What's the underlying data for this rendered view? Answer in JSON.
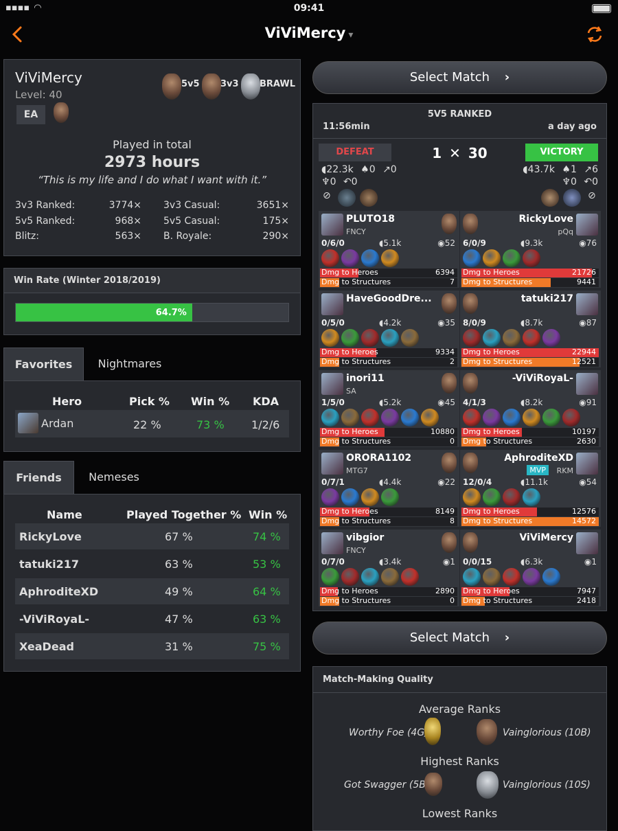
{
  "status_bar": {
    "time": "09:41"
  },
  "nav": {
    "title": "ViViMercy",
    "caret": "▾"
  },
  "profile": {
    "name": "ViViMercy",
    "level": "Level: 40",
    "region": "EA",
    "modes": [
      "5v5",
      "3v3",
      "BRAWL"
    ],
    "played_label": "Played in total",
    "hours": "2973 hours",
    "quote": "“This is my life and I do what I want with it.”",
    "stats": [
      {
        "label": "3v3 Ranked:",
        "value": "3774×"
      },
      {
        "label": "3v3 Casual:",
        "value": "3651×"
      },
      {
        "label": "5v5 Ranked:",
        "value": "968×"
      },
      {
        "label": "5v5 Casual:",
        "value": "175×"
      },
      {
        "label": "Blitz:",
        "value": "563×"
      },
      {
        "label": "B. Royale:",
        "value": "290×"
      }
    ]
  },
  "win_rate": {
    "title": "Win Rate (Winter 2018/2019)",
    "value": "64.7%",
    "fraction": 0.647
  },
  "heroes_tabs": {
    "active": "Favorites",
    "inactive": "Nightmares"
  },
  "heroes_table": {
    "headers": [
      "Hero",
      "Pick %",
      "Win %",
      "KDA"
    ],
    "rows": [
      {
        "hero": "Ardan",
        "pick": "22 %",
        "win": "73 %",
        "kda": "1/2/6"
      }
    ]
  },
  "friends_tabs": {
    "active": "Friends",
    "inactive": "Nemeses"
  },
  "friends_table": {
    "headers": [
      "Name",
      "Played Together %",
      "Win %"
    ],
    "rows": [
      {
        "name": "RickyLove",
        "played": "67 %",
        "win": "74 %"
      },
      {
        "name": "tatuki217",
        "played": "63 %",
        "win": "53 %"
      },
      {
        "name": "AphroditeXD",
        "played": "49 %",
        "win": "64 %"
      },
      {
        "name": "-ViViRoyaL-",
        "played": "47 %",
        "win": "63 %"
      },
      {
        "name": "XeaDead",
        "played": "31 %",
        "win": "75 %"
      }
    ]
  },
  "select_match": {
    "label": "Select Match",
    "arrow": "›"
  },
  "match": {
    "mode": "5V5 RANKED",
    "duration": "11:56min",
    "ago": "a day ago",
    "left_result": "DEFEAT",
    "right_result": "VICTORY",
    "score_left": "1",
    "score_right": "30",
    "left_stats": {
      "gold": "22.3k",
      "kills": "0",
      "towers": "0",
      "krakens": "0",
      "turrets": "0"
    },
    "right_stats": {
      "gold": "43.7k",
      "kills": "1",
      "towers": "6",
      "krakens": "0",
      "turrets": "0"
    },
    "dmg_heroes_label": "Dmg to Heroes",
    "dmg_structures_label": "Dmg to Structures",
    "left_players": [
      {
        "name": "PLUTO18",
        "team": "FNCY",
        "kda": "0/6/0",
        "gold": "5.1k",
        "cs": "52",
        "dmg_heroes": "6394",
        "dmg_struct": "7",
        "dh": 0.28,
        "ds": 0.0005
      },
      {
        "name": "HaveGoodDre...",
        "team": "",
        "kda": "0/5/0",
        "gold": "4.2k",
        "cs": "35",
        "dmg_heroes": "9334",
        "dmg_struct": "2",
        "dh": 0.41,
        "ds": 0.0002
      },
      {
        "name": "inori11",
        "team": "SA",
        "kda": "1/5/0",
        "gold": "5.2k",
        "cs": "45",
        "dmg_heroes": "10880",
        "dmg_struct": "0",
        "dh": 0.47,
        "ds": 0
      },
      {
        "name": "ORORA1102",
        "team": "MTG7",
        "kda": "0/7/1",
        "gold": "4.4k",
        "cs": "22",
        "dmg_heroes": "8149",
        "dmg_struct": "8",
        "dh": 0.36,
        "ds": 0.0006
      },
      {
        "name": "vibgior",
        "team": "FNCY",
        "kda": "0/7/0",
        "gold": "3.4k",
        "cs": "1",
        "dmg_heroes": "2890",
        "dmg_struct": "0",
        "dh": 0.13,
        "ds": 0
      }
    ],
    "right_players": [
      {
        "name": "RickyLove",
        "team": "pQq",
        "kda": "6/0/9",
        "gold": "9.3k",
        "cs": "76",
        "dmg_heroes": "21726",
        "dmg_struct": "9441",
        "dh": 0.95,
        "ds": 0.65,
        "mvp": ""
      },
      {
        "name": "tatuki217",
        "team": "",
        "kda": "8/0/9",
        "gold": "8.7k",
        "cs": "87",
        "dmg_heroes": "22944",
        "dmg_struct": "12521",
        "dh": 1.0,
        "ds": 0.86,
        "mvp": ""
      },
      {
        "name": "-ViViRoyaL-",
        "team": "",
        "kda": "4/1/3",
        "gold": "8.2k",
        "cs": "91",
        "dmg_heroes": "10197",
        "dmg_struct": "2630",
        "dh": 0.44,
        "ds": 0.18,
        "mvp": ""
      },
      {
        "name": "AphroditeXD",
        "team": "RKM",
        "kda": "12/0/4",
        "gold": "11.1k",
        "cs": "54",
        "dmg_heroes": "12576",
        "dmg_struct": "14572",
        "dh": 0.55,
        "ds": 1.0,
        "mvp": "MVP"
      },
      {
        "name": "ViViMercy",
        "team": "",
        "kda": "0/0/15",
        "gold": "6.3k",
        "cs": "1",
        "dmg_heroes": "7947",
        "dmg_struct": "2418",
        "dh": 0.35,
        "ds": 0.17,
        "mvp": ""
      }
    ]
  },
  "mmq": {
    "title": "Match-Making Quality",
    "sections": [
      {
        "title": "Average Ranks",
        "left": "Worthy Foe (4G)",
        "right": "Vainglorious (10B)"
      },
      {
        "title": "Highest Ranks",
        "left": "Got Swagger (5B)",
        "right": "Vainglorious (10S)"
      },
      {
        "title": "Lowest Ranks"
      }
    ]
  },
  "colors": {
    "accent": "#ff7a1a",
    "win": "#37c244",
    "loss": "#e2474a",
    "heroes_bar": "#e03a3a",
    "structures_bar": "#f07a28"
  }
}
